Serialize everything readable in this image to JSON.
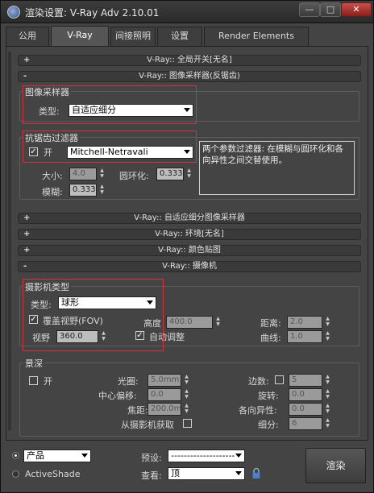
{
  "window": {
    "title": "渲染设置: V-Ray Adv 2.10.01",
    "min": "—",
    "max": "□",
    "close": "✕"
  },
  "tabs": [
    "公用",
    "V-Ray",
    "间接照明",
    "设置",
    "Render Elements"
  ],
  "rollouts": {
    "global": "V-Ray:: 全局开关[无名]",
    "sampler": "V-Ray:: 图像采样器(反锯齿)",
    "adaptive": "V-Ray:: 自适应细分图像采样器",
    "env": "V-Ray:: 环境[无名]",
    "color": "V-Ray:: 颜色贴图",
    "camera": "V-Ray:: 摄像机",
    "plus": "+",
    "minus": "-"
  },
  "image_sampler": {
    "group": "图像采样器",
    "type_label": "类型:",
    "type_value": "自适应细分"
  },
  "aa_filter": {
    "group": "抗锯齿过滤器",
    "on_label": "开",
    "on_checked": true,
    "filter_value": "Mitchell-Netravali",
    "desc": "两个参数过滤器: 在模糊与圆环化和各向异性之间交替使用。",
    "size_label": "大小:",
    "size_value": "4.0",
    "ring_label": "圆环化:",
    "ring_value": "0.333",
    "blur_label": "模糊:",
    "blur_value": "0.333"
  },
  "camera_type": {
    "group": "摄影机类型",
    "type_label": "类型:",
    "type_value": "球形",
    "override_fov_label": "覆盖视野(FOV)",
    "override_fov_checked": true,
    "fov_label": "视野",
    "fov_value": "360.0",
    "height_label": "高度",
    "height_value": "400.0",
    "autofit_label": "自动调整",
    "autofit_checked": true,
    "dist_label": "距离:",
    "dist_value": "2.0",
    "curve_label": "曲线:",
    "curve_value": "1.0"
  },
  "dof": {
    "group": "景深",
    "on_label": "开",
    "on_checked": false,
    "aperture_label": "光圈:",
    "aperture_value": "5.0mm",
    "center_bias_label": "中心偏移:",
    "center_bias_value": "0.0",
    "focal_label": "焦距:",
    "focal_value": "200.0mr",
    "from_cam_label": "从摄影机获取",
    "from_cam_checked": false,
    "sides_label": "边数:",
    "sides_checked": false,
    "sides_value": "5",
    "rotation_label": "旋转:",
    "rotation_value": "0.0",
    "aniso_label": "各向异性:",
    "aniso_value": "0.0",
    "subdivs_label": "细分:",
    "subdivs_value": "6"
  },
  "bottom": {
    "product_label": "产品",
    "activeshade_label": "ActiveShade",
    "preset_label": "预设:",
    "preset_value": "--------------------",
    "view_label": "查看:",
    "view_value": "顶",
    "render_label": "渲染",
    "lock_icon": "lock-icon"
  },
  "colors": {
    "highlight": "#d0333a",
    "panel": "#444444"
  }
}
